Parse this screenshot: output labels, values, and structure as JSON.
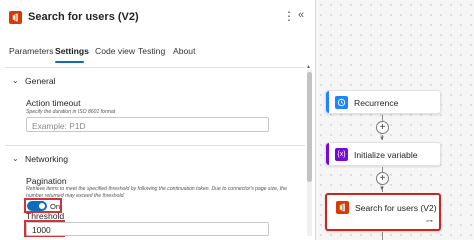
{
  "header": {
    "title": "Search for users (V2)",
    "app_icon": "office-icon",
    "more_icon": "ellipsis-vertical-icon",
    "collapse_icon": "double-chevron-left-icon"
  },
  "tabs": [
    {
      "label": "Parameters"
    },
    {
      "label": "Settings"
    },
    {
      "label": "Code view"
    },
    {
      "label": "Testing"
    },
    {
      "label": "About"
    }
  ],
  "active_tab": "Settings",
  "general": {
    "title": "General",
    "action_timeout": {
      "label": "Action timeout",
      "hint": "Specify the duration in ISO 8601 format",
      "placeholder": "Example: P1D"
    }
  },
  "networking": {
    "title": "Networking",
    "pagination": {
      "label": "Pagination",
      "hint": "Retrieve items to meet the specified threshold by following the continuation token. Due to connector's page size, the number returned may exceed the threshold.",
      "toggle_state": "On"
    },
    "threshold": {
      "label": "Threshold",
      "value": "1000"
    }
  },
  "flow": {
    "steps": [
      {
        "name": "Recurrence",
        "icon": "clock-icon",
        "color": "#1f85ff"
      },
      {
        "name": "Initialize variable",
        "icon": "variable-icon",
        "color": "#770bd6"
      },
      {
        "name": "Search for users (V2)",
        "icon": "office-icon",
        "color": "#d83b01"
      }
    ]
  },
  "colors": {
    "accent": "#0f6cbd",
    "highlight": "#d13438"
  }
}
